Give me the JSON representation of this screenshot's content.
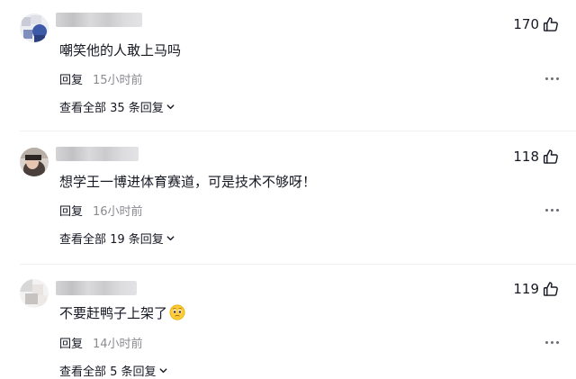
{
  "comments": [
    {
      "text": "嘲笑他的人敢上马吗",
      "likes": "170",
      "reply_label": "回复",
      "time": "15小时前",
      "view_replies": "查看全部 35 条回复"
    },
    {
      "text": "想学王一博进体育赛道，可是技术不够呀！",
      "likes": "118",
      "reply_label": "回复",
      "time": "16小时前",
      "view_replies": "查看全部 19 条回复"
    },
    {
      "text": "不要赶鸭子上架了",
      "likes": "119",
      "reply_label": "回复",
      "time": "14小时前",
      "view_replies": "查看全部 5 条回复"
    }
  ],
  "icons": {
    "like": "thumbs-up-icon",
    "more": "more-dots-icon",
    "chevron": "chevron-down-icon",
    "emoji": "pleading-face-emoji"
  },
  "colors": {
    "text_primary": "#161823",
    "text_secondary": "#8a8b91",
    "divider": "#f0f0f2"
  }
}
